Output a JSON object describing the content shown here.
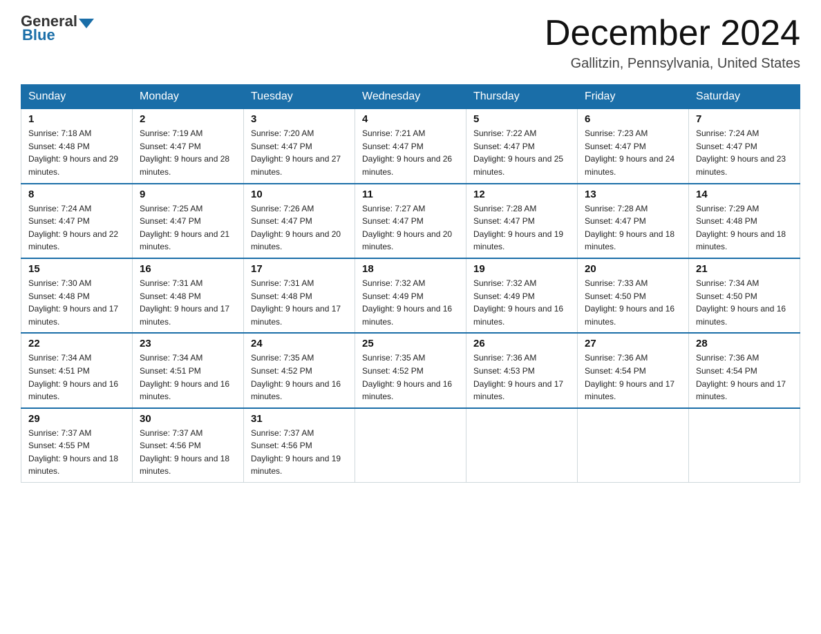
{
  "header": {
    "logo_general": "General",
    "logo_blue": "Blue",
    "month_title": "December 2024",
    "location": "Gallitzin, Pennsylvania, United States"
  },
  "weekdays": [
    "Sunday",
    "Monday",
    "Tuesday",
    "Wednesday",
    "Thursday",
    "Friday",
    "Saturday"
  ],
  "weeks": [
    [
      {
        "day": "1",
        "sunrise": "7:18 AM",
        "sunset": "4:48 PM",
        "daylight": "9 hours and 29 minutes."
      },
      {
        "day": "2",
        "sunrise": "7:19 AM",
        "sunset": "4:47 PM",
        "daylight": "9 hours and 28 minutes."
      },
      {
        "day": "3",
        "sunrise": "7:20 AM",
        "sunset": "4:47 PM",
        "daylight": "9 hours and 27 minutes."
      },
      {
        "day": "4",
        "sunrise": "7:21 AM",
        "sunset": "4:47 PM",
        "daylight": "9 hours and 26 minutes."
      },
      {
        "day": "5",
        "sunrise": "7:22 AM",
        "sunset": "4:47 PM",
        "daylight": "9 hours and 25 minutes."
      },
      {
        "day": "6",
        "sunrise": "7:23 AM",
        "sunset": "4:47 PM",
        "daylight": "9 hours and 24 minutes."
      },
      {
        "day": "7",
        "sunrise": "7:24 AM",
        "sunset": "4:47 PM",
        "daylight": "9 hours and 23 minutes."
      }
    ],
    [
      {
        "day": "8",
        "sunrise": "7:24 AM",
        "sunset": "4:47 PM",
        "daylight": "9 hours and 22 minutes."
      },
      {
        "day": "9",
        "sunrise": "7:25 AM",
        "sunset": "4:47 PM",
        "daylight": "9 hours and 21 minutes."
      },
      {
        "day": "10",
        "sunrise": "7:26 AM",
        "sunset": "4:47 PM",
        "daylight": "9 hours and 20 minutes."
      },
      {
        "day": "11",
        "sunrise": "7:27 AM",
        "sunset": "4:47 PM",
        "daylight": "9 hours and 20 minutes."
      },
      {
        "day": "12",
        "sunrise": "7:28 AM",
        "sunset": "4:47 PM",
        "daylight": "9 hours and 19 minutes."
      },
      {
        "day": "13",
        "sunrise": "7:28 AM",
        "sunset": "4:47 PM",
        "daylight": "9 hours and 18 minutes."
      },
      {
        "day": "14",
        "sunrise": "7:29 AM",
        "sunset": "4:48 PM",
        "daylight": "9 hours and 18 minutes."
      }
    ],
    [
      {
        "day": "15",
        "sunrise": "7:30 AM",
        "sunset": "4:48 PM",
        "daylight": "9 hours and 17 minutes."
      },
      {
        "day": "16",
        "sunrise": "7:31 AM",
        "sunset": "4:48 PM",
        "daylight": "9 hours and 17 minutes."
      },
      {
        "day": "17",
        "sunrise": "7:31 AM",
        "sunset": "4:48 PM",
        "daylight": "9 hours and 17 minutes."
      },
      {
        "day": "18",
        "sunrise": "7:32 AM",
        "sunset": "4:49 PM",
        "daylight": "9 hours and 16 minutes."
      },
      {
        "day": "19",
        "sunrise": "7:32 AM",
        "sunset": "4:49 PM",
        "daylight": "9 hours and 16 minutes."
      },
      {
        "day": "20",
        "sunrise": "7:33 AM",
        "sunset": "4:50 PM",
        "daylight": "9 hours and 16 minutes."
      },
      {
        "day": "21",
        "sunrise": "7:34 AM",
        "sunset": "4:50 PM",
        "daylight": "9 hours and 16 minutes."
      }
    ],
    [
      {
        "day": "22",
        "sunrise": "7:34 AM",
        "sunset": "4:51 PM",
        "daylight": "9 hours and 16 minutes."
      },
      {
        "day": "23",
        "sunrise": "7:34 AM",
        "sunset": "4:51 PM",
        "daylight": "9 hours and 16 minutes."
      },
      {
        "day": "24",
        "sunrise": "7:35 AM",
        "sunset": "4:52 PM",
        "daylight": "9 hours and 16 minutes."
      },
      {
        "day": "25",
        "sunrise": "7:35 AM",
        "sunset": "4:52 PM",
        "daylight": "9 hours and 16 minutes."
      },
      {
        "day": "26",
        "sunrise": "7:36 AM",
        "sunset": "4:53 PM",
        "daylight": "9 hours and 17 minutes."
      },
      {
        "day": "27",
        "sunrise": "7:36 AM",
        "sunset": "4:54 PM",
        "daylight": "9 hours and 17 minutes."
      },
      {
        "day": "28",
        "sunrise": "7:36 AM",
        "sunset": "4:54 PM",
        "daylight": "9 hours and 17 minutes."
      }
    ],
    [
      {
        "day": "29",
        "sunrise": "7:37 AM",
        "sunset": "4:55 PM",
        "daylight": "9 hours and 18 minutes."
      },
      {
        "day": "30",
        "sunrise": "7:37 AM",
        "sunset": "4:56 PM",
        "daylight": "9 hours and 18 minutes."
      },
      {
        "day": "31",
        "sunrise": "7:37 AM",
        "sunset": "4:56 PM",
        "daylight": "9 hours and 19 minutes."
      },
      null,
      null,
      null,
      null
    ]
  ]
}
